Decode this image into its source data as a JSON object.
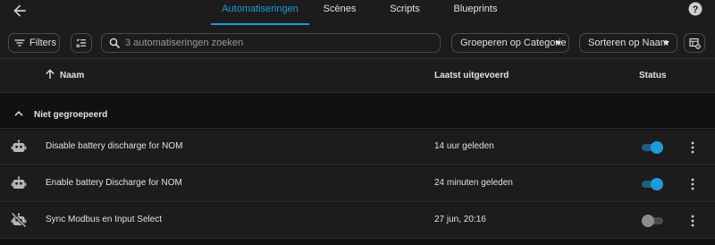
{
  "tabs": [
    {
      "label": "Automatiseringen",
      "active": true
    },
    {
      "label": "Scènes",
      "active": false
    },
    {
      "label": "Scripts",
      "active": false
    },
    {
      "label": "Blueprints",
      "active": false
    }
  ],
  "toolbar": {
    "filters_label": "Filters",
    "search_placeholder": "3 automatiseringen zoeken",
    "group_by_label": "Groeperen op Categorie",
    "sort_by_label": "Sorteren op Naam"
  },
  "table": {
    "columns": {
      "name": "Naam",
      "last_run": "Laatst uitgevoerd",
      "status": "Status"
    },
    "group_label": "Niet gegroepeerd",
    "rows": [
      {
        "icon": "robot-icon",
        "name": "Disable battery discharge for NOM",
        "last_run": "14 uur geleden",
        "enabled": true
      },
      {
        "icon": "robot-icon",
        "name": "Enable battery Discharge for NOM",
        "last_run": "24 minuten geleden",
        "enabled": true
      },
      {
        "icon": "robot-off-icon",
        "name": "Sync Modbus en Input Select",
        "last_run": "27 jun, 20:16",
        "enabled": false
      }
    ]
  },
  "colors": {
    "accent": "#1e9bd6",
    "background": "#111111",
    "surface": "#1c1c1c"
  }
}
